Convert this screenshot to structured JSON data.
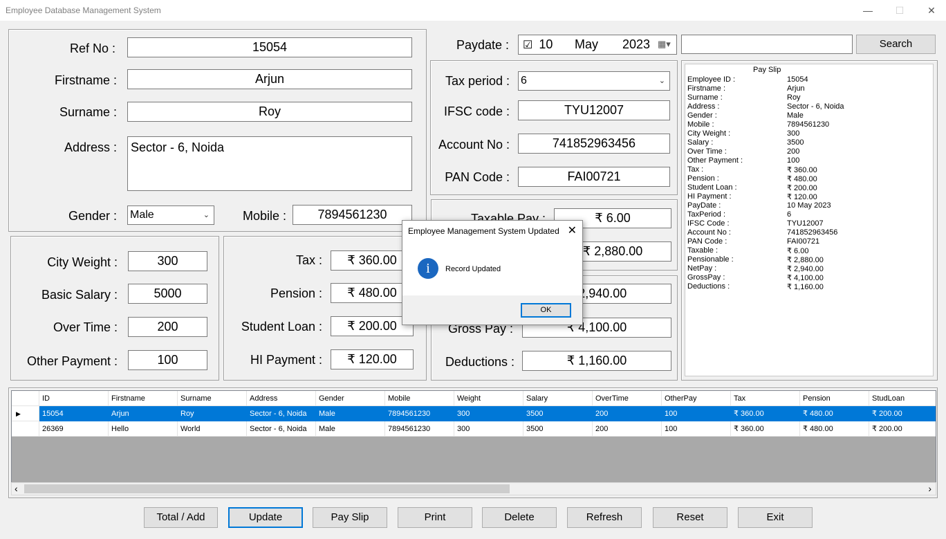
{
  "window": {
    "title": "Employee Database Management System",
    "minimize": "—",
    "maximize": "☐",
    "close": "✕"
  },
  "employee": {
    "ref_label": "Ref No :",
    "ref_value": "15054",
    "firstname_label": "Firstname :",
    "firstname_value": "Arjun",
    "surname_label": "Surname :",
    "surname_value": "Roy",
    "address_label": "Address :",
    "address_value": "Sector - 6, Noida",
    "gender_label": "Gender :",
    "gender_value": "Male",
    "mobile_label": "Mobile :",
    "mobile_value": "7894561230"
  },
  "paydate": {
    "label": "Paydate :",
    "checkbox": "☑",
    "day": "10",
    "month": "May",
    "year": "2023",
    "calendar_icon": "calendar-icon"
  },
  "search": {
    "value": "",
    "button": "Search"
  },
  "bank": {
    "tax_period_label": "Tax period :",
    "tax_period_value": "6",
    "ifsc_label": "IFSC code :",
    "ifsc_value": "TYU12007",
    "account_label": "Account No :",
    "account_value": "741852963456",
    "pan_label": "PAN Code :",
    "pan_value": "FAI00721"
  },
  "salary": {
    "city_label": "City Weight :",
    "city_value": "300",
    "basic_label": "Basic Salary :",
    "basic_value": "5000",
    "overtime_label": "Over Time :",
    "overtime_value": "200",
    "other_label": "Other Payment :",
    "other_value": "100"
  },
  "deductions": {
    "tax_label": "Tax :",
    "tax_value": "₹ 360.00",
    "pension_label": "Pension :",
    "pension_value": "₹ 480.00",
    "student_label": "Student Loan :",
    "student_value": "₹ 200.00",
    "hi_label": "HI Payment :",
    "hi_value": "₹ 120.00"
  },
  "totals": {
    "taxable_label": "Taxable Pay :",
    "taxable_value": "₹ 6.00",
    "pensionable_value": "₹ 2,880.00",
    "netpay_value": "₹ 2,940.00",
    "gross_label": "Gross Pay :",
    "gross_value": "₹ 4,100.00",
    "deductions_label": "Deductions :",
    "deductions_value": "₹ 1,160.00"
  },
  "payslip": {
    "heading": "Pay Slip",
    "rows": [
      {
        "k": "Employee ID :",
        "v": "15054"
      },
      {
        "k": "Firstname :",
        "v": "Arjun"
      },
      {
        "k": "Surname :",
        "v": "Roy"
      },
      {
        "k": "Address :",
        "v": "Sector - 6, Noida"
      },
      {
        "k": "Gender :",
        "v": "Male"
      },
      {
        "k": "Mobile :",
        "v": "7894561230"
      },
      {
        "k": "City Weight :",
        "v": "300"
      },
      {
        "k": "Salary :",
        "v": "3500"
      },
      {
        "k": "Over Time :",
        "v": "200"
      },
      {
        "k": "Other Payment :",
        "v": "100"
      },
      {
        "k": "Tax :",
        "v": "₹ 360.00"
      },
      {
        "k": "Pension :",
        "v": "₹ 480.00"
      },
      {
        "k": "Student Loan :",
        "v": "₹ 200.00"
      },
      {
        "k": "HI Payment :",
        "v": "₹ 120.00"
      },
      {
        "k": "PayDate :",
        "v": "10 May 2023"
      },
      {
        "k": "TaxPeriod :",
        "v": "6"
      },
      {
        "k": "IFSC Code :",
        "v": "TYU12007"
      },
      {
        "k": "Account No :",
        "v": "741852963456"
      },
      {
        "k": "PAN Code :",
        "v": "FAI00721"
      },
      {
        "k": "Taxable :",
        "v": "₹ 6.00"
      },
      {
        "k": "Pensionable :",
        "v": "₹ 2,880.00"
      },
      {
        "k": "NetPay :",
        "v": "₹ 2,940.00"
      },
      {
        "k": "GrossPay :",
        "v": "₹ 4,100.00"
      },
      {
        "k": "Deductions :",
        "v": "₹ 1,160.00"
      }
    ]
  },
  "grid": {
    "columns": [
      "ID",
      "Firstname",
      "Surname",
      "Address",
      "Gender",
      "Mobile",
      "Weight",
      "Salary",
      "OverTime",
      "OtherPay",
      "Tax",
      "Pension",
      "StudLoan"
    ],
    "rows": [
      [
        "15054",
        "Arjun",
        "Roy",
        "Sector - 6, Noida",
        "Male",
        "7894561230",
        "300",
        "3500",
        "200",
        "100",
        "₹ 360.00",
        "₹ 480.00",
        "₹ 200.00"
      ],
      [
        "26369",
        "Hello",
        "World",
        "Sector - 6, Noida",
        "Male",
        "7894561230",
        "300",
        "3500",
        "200",
        "100",
        "₹ 360.00",
        "₹ 480.00",
        "₹ 200.00"
      ]
    ],
    "row_marker": "▶",
    "selected_color": "#0078d7",
    "scroll_left": "‹",
    "scroll_right": "›"
  },
  "buttons": {
    "total": "Total / Add",
    "update": "Update",
    "payslip": "Pay Slip",
    "print": "Print",
    "delete": "Delete",
    "refresh": "Refresh",
    "reset": "Reset",
    "exit": "Exit"
  },
  "dialog": {
    "title": "Employee Management System Updated",
    "close": "✕",
    "icon": "i",
    "message": "Record Updated",
    "ok": "OK"
  }
}
